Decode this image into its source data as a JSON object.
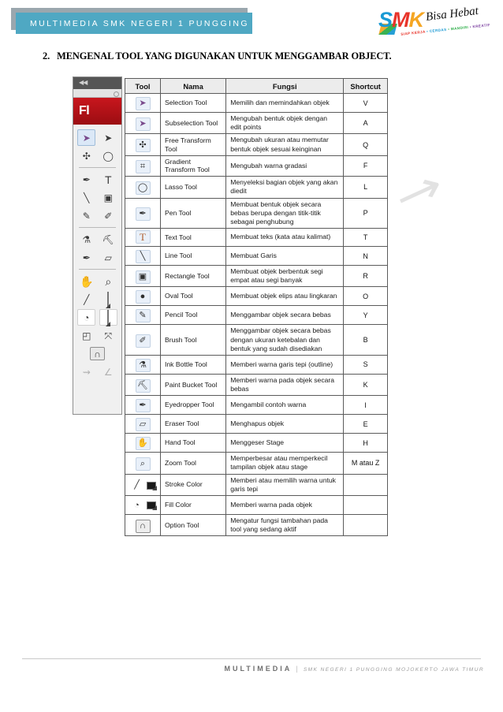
{
  "header": {
    "bar_title": "MULTIMEDIA SMK NEGERI 1 PUNGGING",
    "bar_color": "#4fa8c3",
    "shadow_color": "#9aa7ae"
  },
  "logo": {
    "letters": [
      "S",
      "M",
      "K",
      "■"
    ],
    "tagline": "Bisa Hebat",
    "subline_parts": [
      "SIAP KERJA",
      "• CERDAS",
      "• MANDIRI",
      "• KREATIF"
    ]
  },
  "title": {
    "number": "2.",
    "text": "MENGENAL TOOL YANG DIGUNAKAN UNTUK MENGGAMBAR OBJECT."
  },
  "watermark": {
    "glyph": "↗"
  },
  "flash_panel": {
    "collapse_icon": "◀◀",
    "app_label": "Fl",
    "tool_groups": [
      {
        "tools": [
          {
            "name": "selection-tool",
            "glyph": "➤",
            "selected": true,
            "purple": true
          },
          {
            "name": "subselection-tool",
            "glyph": "➤",
            "selected": false,
            "purple": false
          }
        ]
      },
      {
        "tools": [
          {
            "name": "free-transform-tool",
            "glyph": "✣",
            "selected": false,
            "purple": false
          },
          {
            "name": "lasso-tool",
            "glyph": "◯",
            "selected": false,
            "purple": false
          }
        ]
      }
    ],
    "group2": [
      {
        "tools": [
          {
            "name": "pen-tool",
            "glyph": "✒",
            "selected": false
          },
          {
            "name": "text-tool",
            "glyph": "T",
            "selected": false
          }
        ]
      },
      {
        "tools": [
          {
            "name": "line-tool",
            "glyph": "╲",
            "selected": false
          },
          {
            "name": "rectangle-tool",
            "glyph": "▣",
            "selected": false
          }
        ]
      },
      {
        "tools": [
          {
            "name": "pencil-tool",
            "glyph": "✎",
            "selected": false
          },
          {
            "name": "brush-tool",
            "glyph": "✐",
            "selected": false
          }
        ]
      }
    ],
    "group3": [
      {
        "tools": [
          {
            "name": "ink-bottle-tool",
            "glyph": "⚗",
            "selected": false
          },
          {
            "name": "paint-bucket-tool",
            "glyph": "⛏",
            "selected": false
          }
        ]
      },
      {
        "tools": [
          {
            "name": "eyedropper-tool",
            "glyph": "✒",
            "selected": false
          },
          {
            "name": "eraser-tool",
            "glyph": "▱",
            "selected": false
          }
        ]
      }
    ],
    "group4": [
      {
        "tools": [
          {
            "name": "hand-tool",
            "glyph": "✋",
            "selected": false
          },
          {
            "name": "zoom-tool",
            "glyph": "⌕",
            "selected": false
          }
        ]
      }
    ],
    "colors_row_stroke": {
      "pencil_glyph": "╱",
      "swatch": "#1a1a1a"
    },
    "colors_row_fill": {
      "bucket_glyph": "◔",
      "swatch": "#1f2fe0"
    },
    "options_row": [
      {
        "name": "object-drawing-option",
        "glyph": "◰"
      },
      {
        "name": "snap-option",
        "glyph": "⤧"
      }
    ],
    "magnet_option": {
      "name": "option-tool",
      "glyph": "∩"
    },
    "dim_options": [
      {
        "name": "smooth-option",
        "glyph": "⇝"
      },
      {
        "name": "straighten-option",
        "glyph": "∠"
      }
    ]
  },
  "table": {
    "columns": [
      "Tool",
      "Nama",
      "Fungsi",
      "Shortcut"
    ],
    "rows": [
      {
        "icon": "➤",
        "icon_name": "selection-tool-icon",
        "icon_style": "purple",
        "nama": "Selection Tool",
        "fungsi": "Memilih dan memindahkan objek",
        "shortcut": "V"
      },
      {
        "icon": "➤",
        "icon_name": "subselection-tool-icon",
        "icon_style": "purple",
        "nama": "Subselection Tool",
        "fungsi": "Mengubah bentuk objek dengan edit points",
        "shortcut": "A"
      },
      {
        "icon": "✣",
        "icon_name": "free-transform-tool-icon",
        "icon_style": "normal",
        "nama": "Free Transform Tool",
        "fungsi": "Mengubah ukuran atau memutar bentuk objek sesuai keinginan",
        "shortcut": "Q"
      },
      {
        "icon": "⌗",
        "icon_name": "gradient-transform-tool-icon",
        "icon_style": "normal",
        "nama": "Gradient Transform Tool",
        "fungsi": "Mengubah warna gradasi",
        "shortcut": "F"
      },
      {
        "icon": "◯",
        "icon_name": "lasso-tool-icon",
        "icon_style": "normal",
        "nama": "Lasso Tool",
        "fungsi": "Menyeleksi bagian objek yang akan diedit",
        "shortcut": "L"
      },
      {
        "icon": "✒",
        "icon_name": "pen-tool-icon",
        "icon_style": "normal",
        "nama": "Pen Tool",
        "fungsi": "Membuat bentuk objek secara bebas berupa dengan titik-titik sebagai penghubung",
        "shortcut": "P"
      },
      {
        "icon": "T",
        "icon_name": "text-tool-icon",
        "icon_style": "text",
        "nama": "Text Tool",
        "fungsi": "Membuat teks (kata atau kalimat)",
        "shortcut": "T"
      },
      {
        "icon": "╲",
        "icon_name": "line-tool-icon",
        "icon_style": "normal",
        "nama": "Line Tool",
        "fungsi": "Membuat Garis",
        "shortcut": "N"
      },
      {
        "icon": "▣",
        "icon_name": "rectangle-tool-icon",
        "icon_style": "normal",
        "nama": "Rectangle Tool",
        "fungsi": "Membuat objek berbentuk segi empat atau segi banyak",
        "shortcut": "R"
      },
      {
        "icon": "●",
        "icon_name": "oval-tool-icon",
        "icon_style": "normal",
        "nama": "Oval Tool",
        "fungsi": "Membuat objek elips atau lingkaran",
        "shortcut": "O"
      },
      {
        "icon": "✎",
        "icon_name": "pencil-tool-icon",
        "icon_style": "normal",
        "nama": "Pencil Tool",
        "fungsi": "Menggambar objek secara bebas",
        "shortcut": "Y"
      },
      {
        "icon": "✐",
        "icon_name": "brush-tool-icon",
        "icon_style": "normal",
        "nama": "Brush Tool",
        "fungsi": "Menggambar objek secara bebas dengan ukuran ketebalan dan bentuk yang sudah disediakan",
        "shortcut": "B"
      },
      {
        "icon": "⚗",
        "icon_name": "ink-bottle-tool-icon",
        "icon_style": "normal",
        "nama": "Ink Bottle Tool",
        "fungsi": "Memberi warna garis tepi (outline)",
        "shortcut": "S"
      },
      {
        "icon": "⛏",
        "icon_name": "paint-bucket-tool-icon",
        "icon_style": "normal",
        "nama": "Paint Bucket Tool",
        "fungsi": "Memberi warna pada objek secara bebas",
        "shortcut": "K"
      },
      {
        "icon": "✒",
        "icon_name": "eyedropper-tool-icon",
        "icon_style": "normal",
        "nama": "Eyedropper Tool",
        "fungsi": "Mengambil contoh warna",
        "shortcut": "I"
      },
      {
        "icon": "▱",
        "icon_name": "eraser-tool-icon",
        "icon_style": "normal",
        "nama": "Eraser Tool",
        "fungsi": "Menghapus objek",
        "shortcut": "E"
      },
      {
        "icon": "✋",
        "icon_name": "hand-tool-icon",
        "icon_style": "normal",
        "nama": "Hand Tool",
        "fungsi": "Menggeser Stage",
        "shortcut": "H"
      },
      {
        "icon": "⌕",
        "icon_name": "zoom-tool-icon",
        "icon_style": "normal",
        "nama": "Zoom Tool",
        "fungsi": "Memperbesar atau memperkecil tampilan objek atau stage",
        "shortcut": "M atau Z"
      },
      {
        "icon": "╱",
        "icon_name": "stroke-color-icon",
        "icon_style": "pair",
        "nama": "Stroke Color",
        "fungsi": "Memberi atau memilih warna untuk garis tepi",
        "shortcut": ""
      },
      {
        "icon": "◔",
        "icon_name": "fill-color-icon",
        "icon_style": "pair",
        "nama": "Fill Color",
        "fungsi": "Memberi warna pada objek",
        "shortcut": ""
      },
      {
        "icon": "∩",
        "icon_name": "option-tool-icon",
        "icon_style": "option",
        "nama": "Option Tool",
        "fungsi": "Mengatur fungsi tambahan pada tool yang sedang aktif",
        "shortcut": ""
      }
    ]
  },
  "footer": {
    "main": "MULTIMEDIA",
    "divider": "|",
    "sub": "SMK NEGERI 1 PUNGGING MOJOKERTO JAWA TIMUR"
  }
}
